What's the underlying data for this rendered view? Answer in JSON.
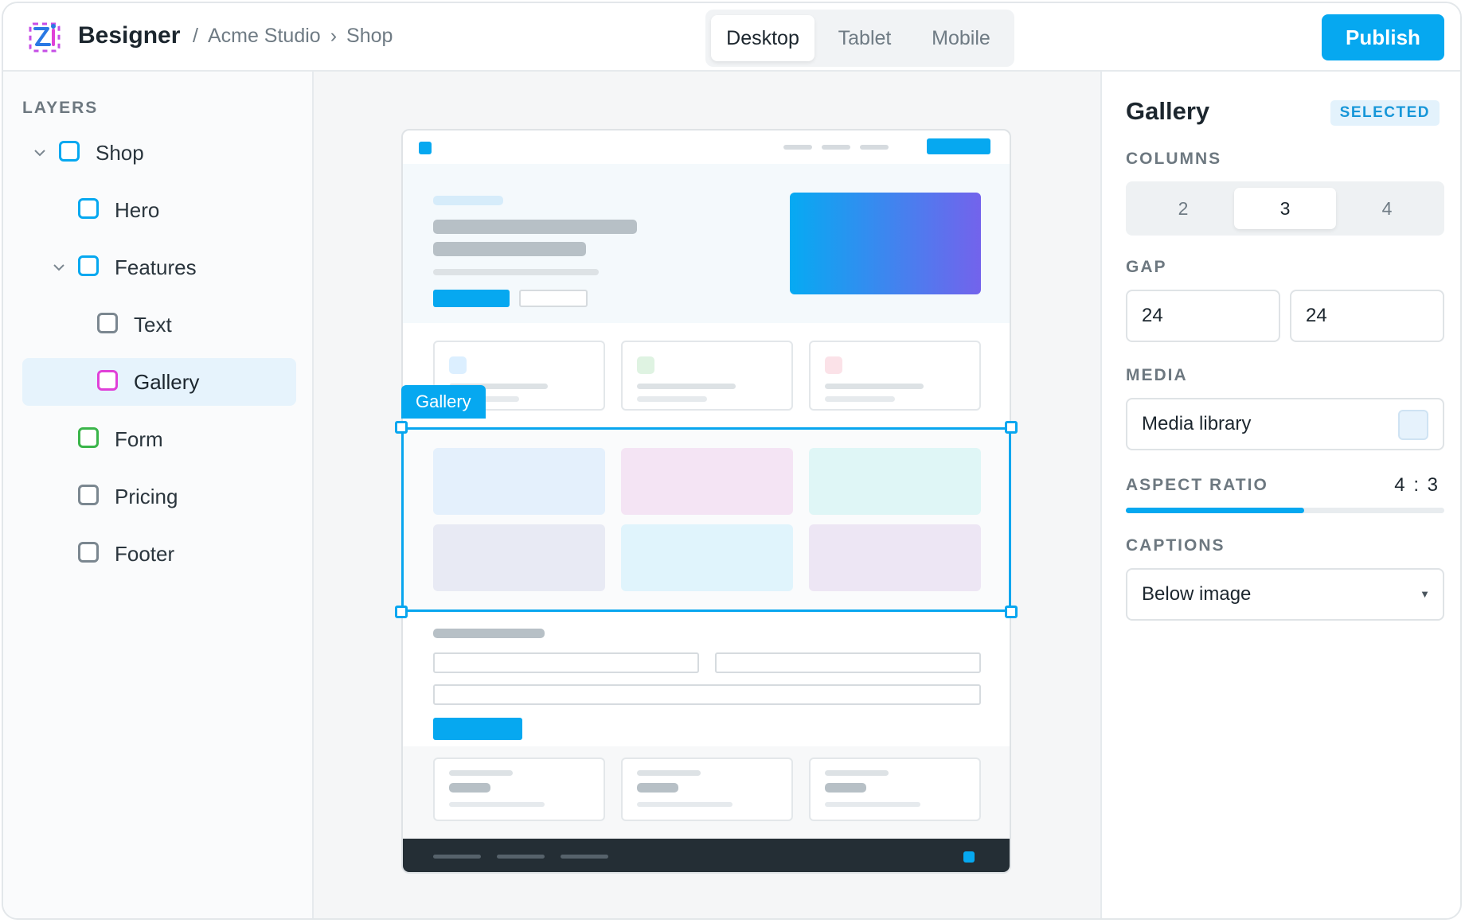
{
  "app": {
    "name": "Besigner"
  },
  "breadcrumb": {
    "sep": "/",
    "arrow": "›",
    "workspace": "Acme Studio",
    "page": "Shop"
  },
  "device_tabs": [
    {
      "label": "Desktop",
      "active": true
    },
    {
      "label": "Tablet",
      "active": false
    },
    {
      "label": "Mobile",
      "active": false
    }
  ],
  "publish_label": "Publish",
  "layers": {
    "title": "LAYERS",
    "items": [
      {
        "label": "Shop",
        "color": "#06a8f0",
        "expanded": true
      },
      {
        "label": "Hero",
        "color": "#06a8f0"
      },
      {
        "label": "Features",
        "color": "#06a8f0",
        "expanded": true
      },
      {
        "label": "Text",
        "color": "#7b8790"
      },
      {
        "label": "Gallery",
        "color": "#e040d8",
        "selected": true
      },
      {
        "label": "Form",
        "color": "#3ab54a"
      },
      {
        "label": "Pricing",
        "color": "#7b8790"
      },
      {
        "label": "Footer",
        "color": "#7b8790"
      }
    ]
  },
  "canvas": {
    "selection_label": "Gallery"
  },
  "inspector": {
    "title": "Gallery",
    "badge": "SELECTED",
    "columns": {
      "label": "COLUMNS",
      "options": [
        "2",
        "3",
        "4"
      ],
      "selected": "3"
    },
    "gap": {
      "label": "GAP",
      "x": "24",
      "y": "24"
    },
    "media": {
      "label": "MEDIA",
      "value": "Media library"
    },
    "aspect_ratio": {
      "label": "ASPECT RATIO",
      "value": "4 : 3",
      "slider_fraction": 0.56
    },
    "captions": {
      "label": "CAPTIONS",
      "value": "Below image"
    }
  },
  "colors": {
    "accent": "#06a8f0",
    "selected_row": "#e6f3fc",
    "footer_dark": "#242e35"
  }
}
